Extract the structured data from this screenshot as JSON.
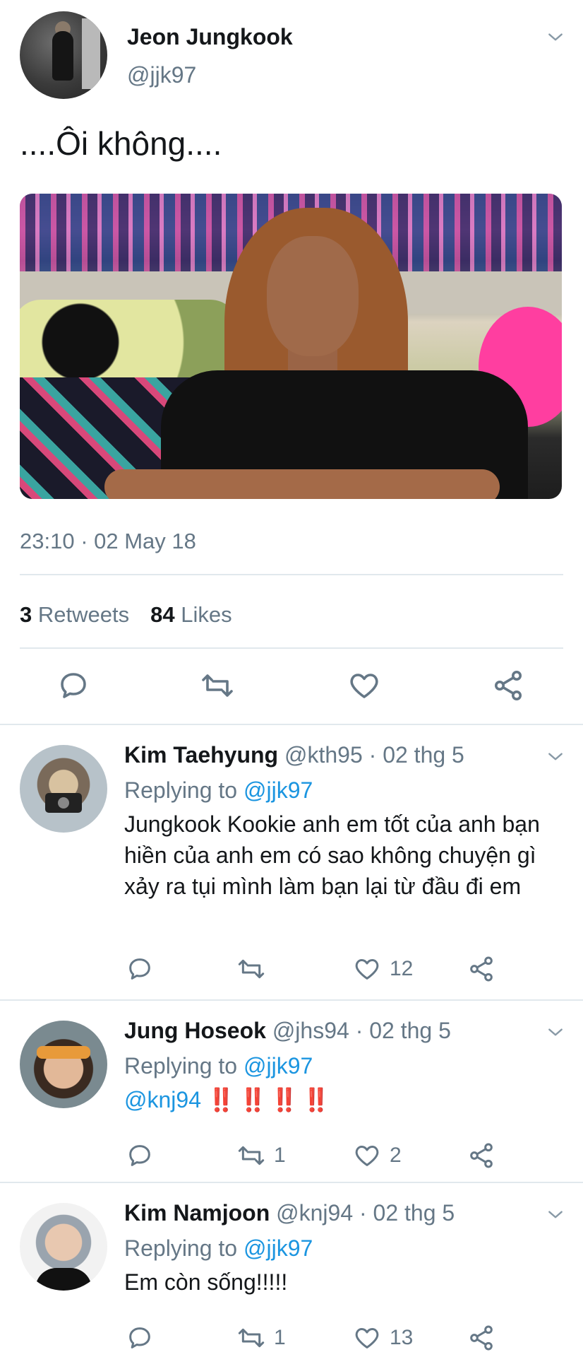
{
  "colors": {
    "accent": "#1b95e0",
    "text": "#14171a",
    "muted": "#657786",
    "divider": "#e1e8ed",
    "exclamation": "#d0021b"
  },
  "main_tweet": {
    "name": "Jeon Jungkook",
    "handle": "@jjk97",
    "text": "....Ôi không....",
    "timestamp": "23:10 · 02 May 18",
    "retweets_count": "3",
    "retweets_label": "Retweets",
    "likes_count": "84",
    "likes_label": "Likes",
    "icons": [
      "reply-icon",
      "retweet-icon",
      "like-icon",
      "share-icon",
      "chevron-down-icon"
    ]
  },
  "replies": [
    {
      "name": "Kim Taehyung",
      "handle": "@kth95",
      "date": "· 02 thg 5",
      "replying_prefix": "Replying to",
      "replying_to": "@jjk97",
      "text": "Jungkook Kookie anh em tốt của anh bạn hiền của anh em có sao không chuyện gì xảy ra tụi mình làm bạn lại từ đầu đi em",
      "retweets": "",
      "likes": "12"
    },
    {
      "name": "Jung Hoseok",
      "handle": "@jhs94",
      "date": "· 02 thg 5",
      "replying_prefix": "Replying to",
      "replying_to": "@jjk97",
      "mention": "@knj94",
      "text_emoji": "‼️ ‼️ ‼️ ‼️",
      "retweets": "1",
      "likes": "2"
    },
    {
      "name": "Kim Namjoon",
      "handle": "@knj94",
      "date": "· 02 thg 5",
      "replying_prefix": "Replying to",
      "replying_to": "@jjk97",
      "text": "Em còn sống!!!!!",
      "retweets": "1",
      "likes": "13"
    }
  ]
}
